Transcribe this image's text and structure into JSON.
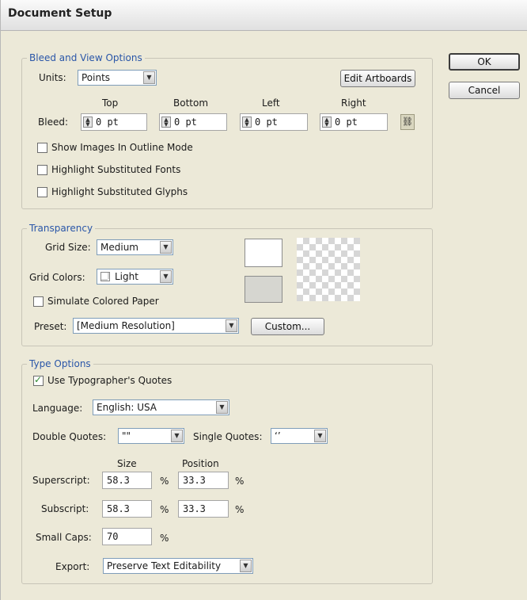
{
  "dialog": {
    "title": "Document Setup"
  },
  "buttons": {
    "ok": "OK",
    "cancel": "Cancel"
  },
  "bleed_view": {
    "legend": "Bleed and View Options",
    "units_label": "Units:",
    "units_value": "Points",
    "edit_artboards": "Edit Artboards",
    "bleed_label": "Bleed:",
    "headers": {
      "top": "Top",
      "bottom": "Bottom",
      "left": "Left",
      "right": "Right"
    },
    "values": {
      "top": "0 pt",
      "bottom": "0 pt",
      "left": "0 pt",
      "right": "0 pt"
    },
    "show_images_outline": {
      "label": "Show Images In Outline Mode",
      "checked": false
    },
    "highlight_fonts": {
      "label": "Highlight Substituted Fonts",
      "checked": false
    },
    "highlight_glyphs": {
      "label": "Highlight Substituted Glyphs",
      "checked": false
    }
  },
  "transparency": {
    "legend": "Transparency",
    "grid_size_label": "Grid Size:",
    "grid_size_value": "Medium",
    "grid_colors_label": "Grid Colors:",
    "grid_colors_value": "Light",
    "simulate_paper": {
      "label": "Simulate Colored Paper",
      "checked": false
    },
    "preset_label": "Preset:",
    "preset_value": "[Medium Resolution]",
    "custom_button": "Custom...",
    "colors": {
      "swatch_top": "#ffffff",
      "swatch_bottom": "#d6d6d0"
    }
  },
  "type_options": {
    "legend": "Type Options",
    "typographers_quotes": {
      "label": "Use Typographer's Quotes",
      "checked": true
    },
    "language_label": "Language:",
    "language_value": "English: USA",
    "double_quotes_label": "Double Quotes:",
    "double_quotes_value": "\"\"",
    "single_quotes_label": "Single Quotes:",
    "single_quotes_value": "‘’",
    "size_header": "Size",
    "position_header": "Position",
    "superscript_label": "Superscript:",
    "superscript_size": "58.3",
    "superscript_position": "33.3",
    "subscript_label": "Subscript:",
    "subscript_size": "58.3",
    "subscript_position": "33.3",
    "small_caps_label": "Small Caps:",
    "small_caps_value": "70",
    "percent": "%",
    "export_label": "Export:",
    "export_value": "Preserve Text Editability"
  }
}
